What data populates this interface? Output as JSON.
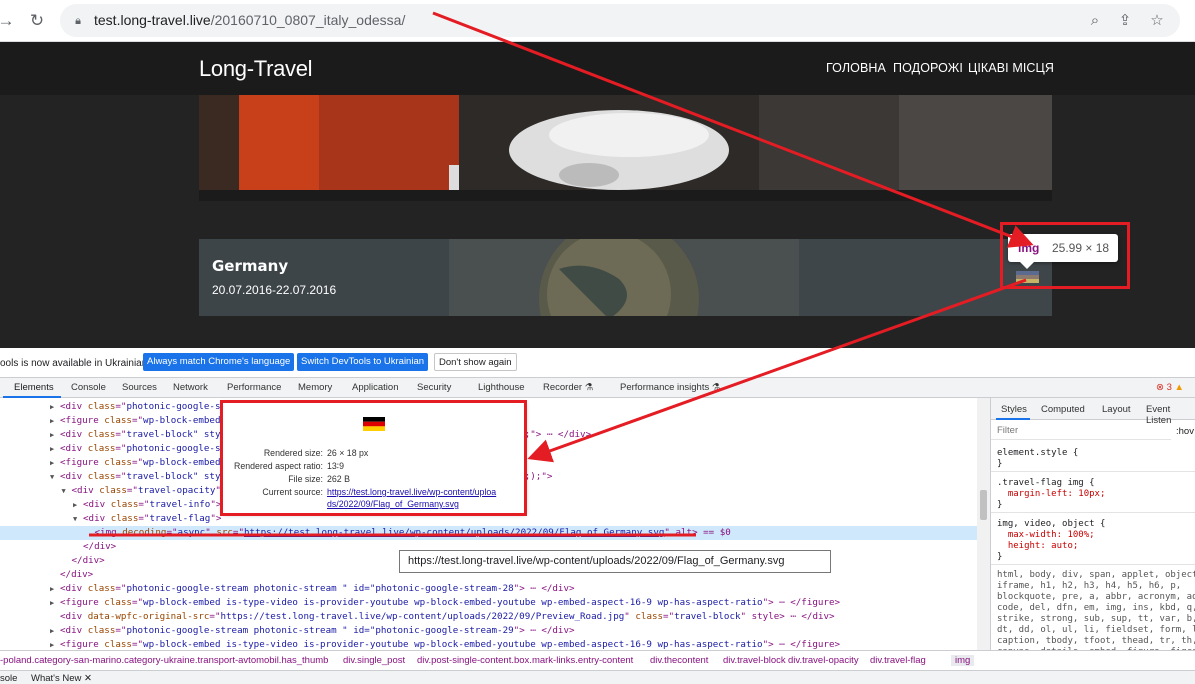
{
  "browser": {
    "url_host": "test.long-travel.live",
    "url_path": "/20160710_0807_italy_odessa/"
  },
  "site": {
    "logo": "Long-Travel",
    "nav": [
      "ГОЛОВНА",
      "ПОДОРОЖІ",
      "ЦІКАВІ МІСЦЯ"
    ],
    "travel_title": "Germany",
    "travel_dates": "20.07.2016-22.07.2016"
  },
  "infobar": {
    "text": "ools is now available in Ukrainian!",
    "btn_match": "Always match Chrome's language",
    "btn_switch": "Switch DevTools to Ukrainian",
    "btn_dismiss": "Don't show again"
  },
  "devtools": {
    "tabs": [
      "Elements",
      "Console",
      "Sources",
      "Network",
      "Performance",
      "Memory",
      "Application",
      "Security",
      "Lighthouse",
      "Recorder ⚗",
      "Performance insights ⚗"
    ],
    "errors_count": "3",
    "styles_tabs": [
      "Styles",
      "Computed",
      "Layout",
      "Event Listen"
    ],
    "filter_placeholder": "Filter",
    "filter_hov": ":hov",
    "style_rules": [
      "element.style {",
      "}",
      ".travel-flag img {",
      "  margin-left: 10px;",
      "}",
      "img, video, object {",
      "  max-width: 100%;",
      "  height: auto;",
      "}",
      "html, body, div, span, applet, object,",
      "iframe, h1, h2, h3, h4, h5, h6, p,",
      "blockquote, pre, a, abbr, acronym, addr",
      "code, del, dfn, em, img, ins, kbd, q, s",
      "strike, strong, sub, sup, tt, var, b, u",
      "dt, dd, ol, ul, li, fieldset, form, lab",
      "caption, tbody, tfoot, thead, tr, th, t",
      "canvas, details, embed, figure, figcap",
      "header, hgroup, menu, nav, output, rub"
    ],
    "dom_lines": [
      {
        "indent": 4,
        "tri": "▶",
        "tag": "div",
        "attrs": [
          [
            "class",
            "photonic-google-str"
          ]
        ],
        "tail": ""
      },
      {
        "indent": 4,
        "tri": "▶",
        "tag": "figure",
        "attrs": [
          [
            "class",
            "wp-block-embed i"
          ]
        ],
        "tail": "embed-aspect-16-9 wp-has-aspect-ratio\"> ⋯ </figure>"
      },
      {
        "indent": 4,
        "tri": "▶",
        "tag": "div",
        "attrs": [
          [
            "class",
            "travel-block\" styl"
          ]
        ],
        "tail": "e/wp-content/uploads/2022/09/Preview_Hotel.jpg&quot;);\"> ⋯ </div>"
      },
      {
        "indent": 4,
        "tri": "▶",
        "tag": "div",
        "attrs": [
          [
            "class",
            "photonic-google-str"
          ]
        ],
        "tail": ""
      },
      {
        "indent": 4,
        "tri": "▶",
        "tag": "figure",
        "attrs": [
          [
            "class",
            "wp-block-embed i"
          ]
        ],
        "tail": "embed-aspect-4-3 wp-has-aspect-ratio\"> ⋯ </figure>"
      },
      {
        "indent": 4,
        "tri": "▼",
        "tag": "div",
        "attrs": [
          [
            "class",
            "travel-block\" styl"
          ]
        ],
        "tail": "e/wp-content/uploads/2022/10/preview_country.jpg&quot;);\">"
      },
      {
        "indent": 5,
        "tri": "▼",
        "tag": "div",
        "attrs": [
          [
            "class",
            "travel-opacity"
          ]
        ],
        "tail": ">"
      },
      {
        "indent": 6,
        "tri": "▶",
        "tag": "div",
        "attrs": [
          [
            "class",
            "travel-info"
          ]
        ],
        "tail": "> ⋯ </"
      },
      {
        "indent": 6,
        "tri": "▼",
        "tag": "div",
        "attrs": [
          [
            "class",
            "travel-flag"
          ]
        ],
        "tail": ">"
      },
      {
        "indent": 7,
        "tri": "",
        "tag": "img",
        "attrs": [
          [
            "decoding",
            "async"
          ],
          [
            "src",
            "https://test.long-travel.live/wp-content/uploads/2022/09/Flag_of_Germany.svg"
          ]
        ],
        "tail": " alt> == $0"
      },
      {
        "indent": 6,
        "tri": "",
        "tag": "",
        "attrs": [],
        "tail": "</div>"
      },
      {
        "indent": 5,
        "tri": "",
        "tag": "",
        "attrs": [],
        "tail": "</div>"
      },
      {
        "indent": 4,
        "tri": "",
        "tag": "",
        "attrs": [],
        "tail": "</div>"
      },
      {
        "indent": 4,
        "tri": "▶",
        "tag": "div",
        "attrs": [
          [
            "class",
            "photonic-google-stream photonic-stream \" id=\"photonic-google-stream-28"
          ]
        ],
        "tail": "> ⋯ </div>"
      },
      {
        "indent": 4,
        "tri": "▶",
        "tag": "figure",
        "attrs": [
          [
            "class",
            "wp-block-embed is-type-video is-provider-youtube wp-block-embed-youtube wp-embed-aspect-16-9 wp-has-aspect-ratio"
          ]
        ],
        "tail": "> ⋯ </figure>"
      },
      {
        "indent": 4,
        "tri": "",
        "tag": "div",
        "attrs": [
          [
            "data-wpfc-original-src",
            "https://test.long-travel.live/wp-content/uploads/2022/09/Preview_Road.jpg"
          ],
          [
            "class",
            "travel-block"
          ]
        ],
        "tail": " style> ⋯ </div>"
      },
      {
        "indent": 4,
        "tri": "▶",
        "tag": "div",
        "attrs": [
          [
            "class",
            "photonic-google-stream photonic-stream \" id=\"photonic-google-stream-29"
          ]
        ],
        "tail": "> ⋯ </div>"
      },
      {
        "indent": 4,
        "tri": "▶",
        "tag": "figure",
        "attrs": [
          [
            "class",
            "wp-block-embed is-type-video is-provider-youtube wp-block-embed-youtube wp-embed-aspect-16-9 wp-has-aspect-ratio"
          ]
        ],
        "tail": "> ⋯ </figure>"
      }
    ],
    "breadcrumb": [
      "-poland.category-san-marino.category-ukraine.transport-avtomobil.has_thumb",
      "div.single_post",
      "div.post-single-content.box.mark-links.entry-content",
      "div.thecontent",
      "div.travel-block",
      "div.travel-opacity",
      "div.travel-flag",
      "img"
    ],
    "drawer_tabs": [
      "sole",
      "What's New"
    ]
  },
  "img_tooltip": {
    "tag": "img",
    "size": "25.99 × 18"
  },
  "hover_popup": {
    "rendered_size_label": "Rendered size:",
    "rendered_size": "26 × 18 px",
    "aspect_label": "Rendered aspect ratio:",
    "aspect": "13∶9",
    "filesize_label": "File size:",
    "filesize": "262 B",
    "source_label": "Current source:",
    "source_line1": "https://test.long-travel.live/wp-content/uploa",
    "source_line2": "ds/2022/09/Flag_of_Germany.svg"
  },
  "url_tooltip": "https://test.long-travel.live/wp-content/uploads/2022/09/Flag_of_Germany.svg",
  "colors": {
    "annotation_red": "#e41c23",
    "devtools_blue": "#1a73e8",
    "tag_purple": "#881280"
  }
}
